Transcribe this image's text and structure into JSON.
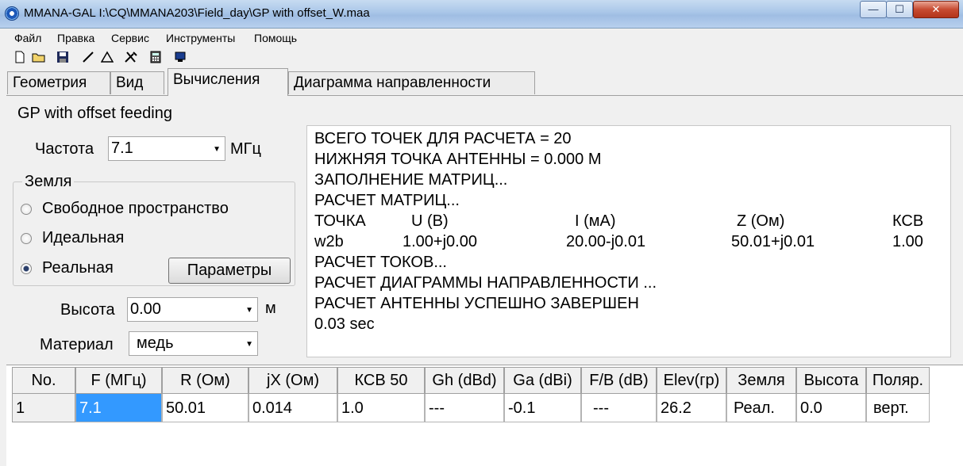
{
  "window": {
    "title": "MMANA-GAL I:\\CQ\\MMANA203\\Field_day\\GP with offset_W.maa",
    "min": "—",
    "max": "☐",
    "close": "✕"
  },
  "menu": [
    "Файл",
    "Правка",
    "Сервис",
    "Инструменты",
    "Помощь"
  ],
  "toolbar": [
    "new-file-icon",
    "open-folder-icon",
    "save-icon",
    "line-tool-icon",
    "triangle-tool-icon",
    "tools-icon",
    "calculator-icon",
    "export-icon"
  ],
  "tabs": [
    "Геометрия",
    "Вид",
    "Вычисления",
    "Диаграмма направленности"
  ],
  "active_tab": 2,
  "antenna_name": "GP  with offset feeding",
  "frequency": {
    "label": "Частота",
    "value": "7.1",
    "unit": "МГц"
  },
  "ground": {
    "legend": "Земля",
    "options": [
      "Свободное пространство",
      "Идеальная",
      "Реальная"
    ],
    "selected": 2,
    "params_button": "Параметры"
  },
  "height": {
    "label": "Высота",
    "value": "0.00",
    "unit": "м"
  },
  "material": {
    "label": "Материал",
    "value": "медь"
  },
  "log": {
    "lines": [
      "ВСЕГО ТОЧЕК ДЛЯ РАСЧЕТА = 20",
      "НИЖНЯЯ ТОЧКА АНТЕННЫ = 0.000 М",
      "ЗАПОЛНЕНИЕ МАТРИЦ...",
      "РАСЧЕТ МАТРИЦ..."
    ],
    "table_header": [
      "ТОЧКА",
      "U (В)",
      "I (мА)",
      "Z (Ом)",
      "КСВ"
    ],
    "table_row": [
      "w2b",
      "1.00+j0.00",
      "20.00-j0.01",
      "50.01+j0.01",
      "1.00"
    ],
    "lines_after": [
      "РАСЧЕТ ТОКОВ...",
      "РАСЧЕТ ДИАГРАММЫ НАПРАВЛЕННОСТИ ...",
      "РАСЧЕТ АНТЕННЫ УСПЕШНО ЗАВЕРШЕН",
      "0.03 sec"
    ]
  },
  "grid": {
    "columns": [
      "No.",
      "F (МГц)",
      "R (Ом)",
      "jX (Ом)",
      "КСВ 50",
      "Gh (dBd)",
      "Ga (dBi)",
      "F/B (dB)",
      "Elev(гр)",
      "Земля",
      "Высота",
      "Поляр."
    ],
    "rows": [
      [
        "1",
        "7.1",
        "50.01",
        "0.014",
        "1.0",
        "---",
        "-0.1",
        "---",
        "26.2",
        "Реал.",
        "0.0",
        "верт."
      ]
    ]
  },
  "colors": {
    "selection": "#3399ff",
    "titlebar": "#a9c6e8"
  }
}
